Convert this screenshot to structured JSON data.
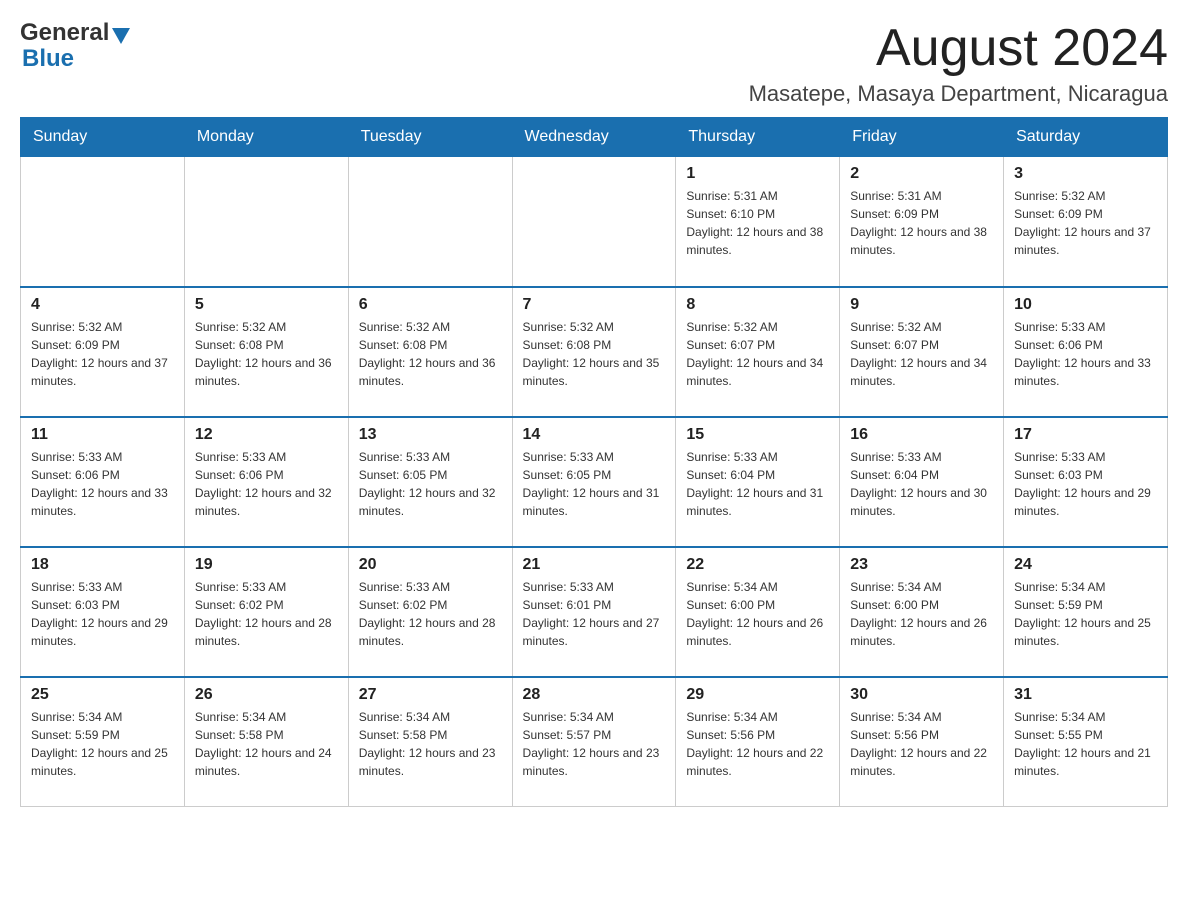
{
  "header": {
    "logo_general": "General",
    "logo_triangle": "",
    "logo_blue": "Blue",
    "month_title": "August 2024",
    "location": "Masatepe, Masaya Department, Nicaragua"
  },
  "weekdays": [
    "Sunday",
    "Monday",
    "Tuesday",
    "Wednesday",
    "Thursday",
    "Friday",
    "Saturday"
  ],
  "weeks": [
    [
      {
        "day": "",
        "info": ""
      },
      {
        "day": "",
        "info": ""
      },
      {
        "day": "",
        "info": ""
      },
      {
        "day": "",
        "info": ""
      },
      {
        "day": "1",
        "info": "Sunrise: 5:31 AM\nSunset: 6:10 PM\nDaylight: 12 hours and 38 minutes."
      },
      {
        "day": "2",
        "info": "Sunrise: 5:31 AM\nSunset: 6:09 PM\nDaylight: 12 hours and 38 minutes."
      },
      {
        "day": "3",
        "info": "Sunrise: 5:32 AM\nSunset: 6:09 PM\nDaylight: 12 hours and 37 minutes."
      }
    ],
    [
      {
        "day": "4",
        "info": "Sunrise: 5:32 AM\nSunset: 6:09 PM\nDaylight: 12 hours and 37 minutes."
      },
      {
        "day": "5",
        "info": "Sunrise: 5:32 AM\nSunset: 6:08 PM\nDaylight: 12 hours and 36 minutes."
      },
      {
        "day": "6",
        "info": "Sunrise: 5:32 AM\nSunset: 6:08 PM\nDaylight: 12 hours and 36 minutes."
      },
      {
        "day": "7",
        "info": "Sunrise: 5:32 AM\nSunset: 6:08 PM\nDaylight: 12 hours and 35 minutes."
      },
      {
        "day": "8",
        "info": "Sunrise: 5:32 AM\nSunset: 6:07 PM\nDaylight: 12 hours and 34 minutes."
      },
      {
        "day": "9",
        "info": "Sunrise: 5:32 AM\nSunset: 6:07 PM\nDaylight: 12 hours and 34 minutes."
      },
      {
        "day": "10",
        "info": "Sunrise: 5:33 AM\nSunset: 6:06 PM\nDaylight: 12 hours and 33 minutes."
      }
    ],
    [
      {
        "day": "11",
        "info": "Sunrise: 5:33 AM\nSunset: 6:06 PM\nDaylight: 12 hours and 33 minutes."
      },
      {
        "day": "12",
        "info": "Sunrise: 5:33 AM\nSunset: 6:06 PM\nDaylight: 12 hours and 32 minutes."
      },
      {
        "day": "13",
        "info": "Sunrise: 5:33 AM\nSunset: 6:05 PM\nDaylight: 12 hours and 32 minutes."
      },
      {
        "day": "14",
        "info": "Sunrise: 5:33 AM\nSunset: 6:05 PM\nDaylight: 12 hours and 31 minutes."
      },
      {
        "day": "15",
        "info": "Sunrise: 5:33 AM\nSunset: 6:04 PM\nDaylight: 12 hours and 31 minutes."
      },
      {
        "day": "16",
        "info": "Sunrise: 5:33 AM\nSunset: 6:04 PM\nDaylight: 12 hours and 30 minutes."
      },
      {
        "day": "17",
        "info": "Sunrise: 5:33 AM\nSunset: 6:03 PM\nDaylight: 12 hours and 29 minutes."
      }
    ],
    [
      {
        "day": "18",
        "info": "Sunrise: 5:33 AM\nSunset: 6:03 PM\nDaylight: 12 hours and 29 minutes."
      },
      {
        "day": "19",
        "info": "Sunrise: 5:33 AM\nSunset: 6:02 PM\nDaylight: 12 hours and 28 minutes."
      },
      {
        "day": "20",
        "info": "Sunrise: 5:33 AM\nSunset: 6:02 PM\nDaylight: 12 hours and 28 minutes."
      },
      {
        "day": "21",
        "info": "Sunrise: 5:33 AM\nSunset: 6:01 PM\nDaylight: 12 hours and 27 minutes."
      },
      {
        "day": "22",
        "info": "Sunrise: 5:34 AM\nSunset: 6:00 PM\nDaylight: 12 hours and 26 minutes."
      },
      {
        "day": "23",
        "info": "Sunrise: 5:34 AM\nSunset: 6:00 PM\nDaylight: 12 hours and 26 minutes."
      },
      {
        "day": "24",
        "info": "Sunrise: 5:34 AM\nSunset: 5:59 PM\nDaylight: 12 hours and 25 minutes."
      }
    ],
    [
      {
        "day": "25",
        "info": "Sunrise: 5:34 AM\nSunset: 5:59 PM\nDaylight: 12 hours and 25 minutes."
      },
      {
        "day": "26",
        "info": "Sunrise: 5:34 AM\nSunset: 5:58 PM\nDaylight: 12 hours and 24 minutes."
      },
      {
        "day": "27",
        "info": "Sunrise: 5:34 AM\nSunset: 5:58 PM\nDaylight: 12 hours and 23 minutes."
      },
      {
        "day": "28",
        "info": "Sunrise: 5:34 AM\nSunset: 5:57 PM\nDaylight: 12 hours and 23 minutes."
      },
      {
        "day": "29",
        "info": "Sunrise: 5:34 AM\nSunset: 5:56 PM\nDaylight: 12 hours and 22 minutes."
      },
      {
        "day": "30",
        "info": "Sunrise: 5:34 AM\nSunset: 5:56 PM\nDaylight: 12 hours and 22 minutes."
      },
      {
        "day": "31",
        "info": "Sunrise: 5:34 AM\nSunset: 5:55 PM\nDaylight: 12 hours and 21 minutes."
      }
    ]
  ]
}
